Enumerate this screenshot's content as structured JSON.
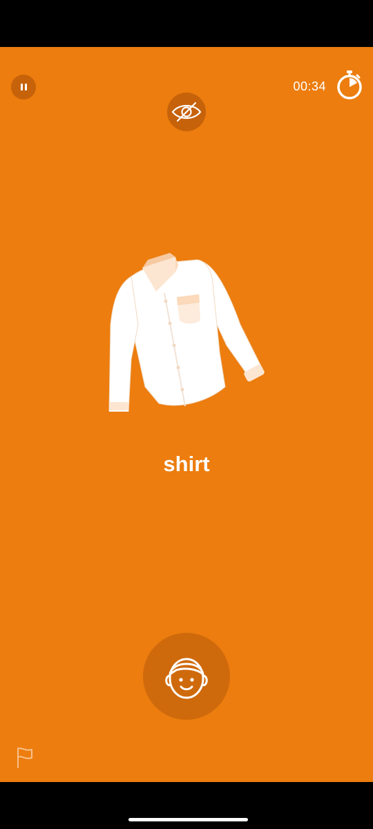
{
  "app": {
    "background_color": "#EC7D0E",
    "button_color": "#C6620A"
  },
  "top_bar": {
    "pause_icon": "pause-icon",
    "timer": "00:34",
    "stopwatch_icon": "stopwatch-icon",
    "hide_icon": "eye-slash-icon"
  },
  "card": {
    "image_icon": "shirt-illustration",
    "word": "shirt"
  },
  "bottom": {
    "speak_icon": "face-speak-icon",
    "report_icon": "flag-icon"
  }
}
